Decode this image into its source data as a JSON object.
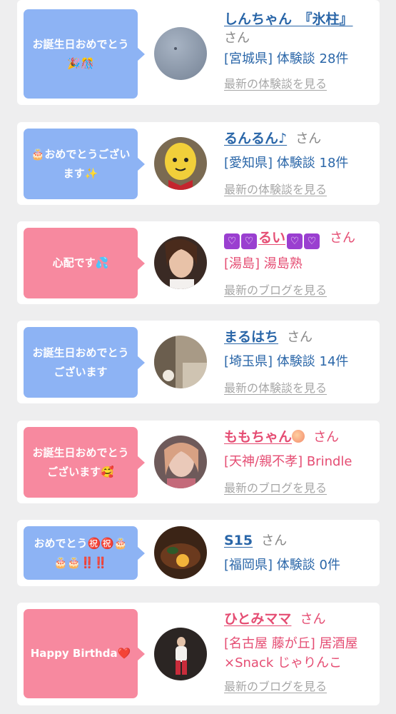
{
  "cards": [
    {
      "bubble": "お誕生日おめでとう🎉🎊",
      "bubble_color": "#8db3f4",
      "name": "しんちゃん　『氷柱』",
      "suffix": "さん",
      "location": "[宮城県] 体験談 28件",
      "link": "最新の体験談を見る",
      "theme": "blue"
    },
    {
      "bubble": "🎂おめでとうございます✨",
      "bubble_color": "#8db3f4",
      "name": "るんるん♪",
      "suffix": "さん",
      "location": "[愛知県] 体験談 18件",
      "link": "最新の体験談を見る",
      "theme": "blue"
    },
    {
      "bubble": "心配です💦",
      "bubble_color": "#f7899f",
      "name": "るい",
      "suffix": "さん",
      "location": "[湯島] 湯島熟",
      "link": "最新のブログを見る",
      "theme": "pink"
    },
    {
      "bubble": "お誕生日おめでとうございます",
      "bubble_color": "#8db3f4",
      "name": "まるはち",
      "suffix": "さん",
      "location": "[埼玉県] 体験談 14件",
      "link": "最新の体験談を見る",
      "theme": "blue"
    },
    {
      "bubble": "お誕生日おめでとうございます🥰",
      "bubble_color": "#f7899f",
      "name": "ももちゃん",
      "suffix": "さん",
      "location": "[天神/親不孝] Brindle",
      "link": "最新のブログを見る",
      "theme": "pink"
    },
    {
      "bubble": "おめでとう㊗️㊗️🎂🎂🎂‼️‼️",
      "bubble_color": "#8db3f4",
      "name": "S15",
      "suffix": "さん",
      "location": "[福岡県] 体験談 0件",
      "link": "",
      "theme": "blue"
    },
    {
      "bubble": "Happy Birthda❤️",
      "bubble_color": "#f7899f",
      "name": "ひとみママ",
      "suffix": "さん",
      "location": "[名古屋 藤が丘] 居酒屋×Snack じゃりんこ",
      "link": "最新のブログを見る",
      "theme": "pink"
    }
  ],
  "colors": {
    "background": "#eeeeef",
    "card": "#ffffff",
    "blue_text": "#2a66a8",
    "pink_text": "#e54d73",
    "link_gray": "#a6a6a6"
  }
}
